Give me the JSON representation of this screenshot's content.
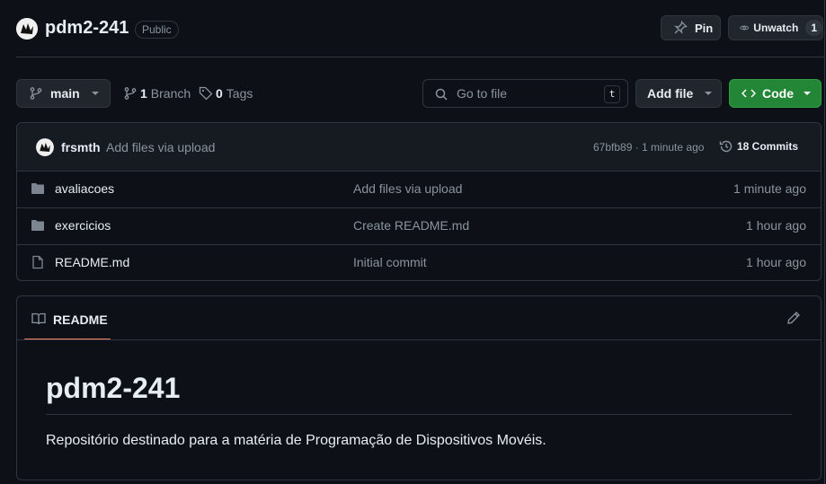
{
  "repo": {
    "name": "pdm2-241",
    "visibility": "Public",
    "avatar_icon": "avatar-icon"
  },
  "actions": {
    "pin_label": "Pin",
    "unwatch_label": "Unwatch",
    "watch_count": "1"
  },
  "branch_bar": {
    "branch_name": "main",
    "branch_count": "1",
    "branch_label": "Branch",
    "tag_count": "0",
    "tag_label": "Tags",
    "goto_placeholder": "Go to file",
    "goto_shortcut": "t",
    "add_file_label": "Add file",
    "code_label": "Code"
  },
  "latest_commit": {
    "author": "frsmth",
    "message": "Add files via upload",
    "hash_time": "67bfb89 · 1 minute ago",
    "commits_label": "18 Commits"
  },
  "files": [
    {
      "type": "folder",
      "name": "avaliacoes",
      "message": "Add files via upload",
      "time": "1 minute ago"
    },
    {
      "type": "folder",
      "name": "exercicios",
      "message": "Create README.md",
      "time": "1 hour ago"
    },
    {
      "type": "file",
      "name": "README.md",
      "message": "Initial commit",
      "time": "1 hour ago"
    }
  ],
  "readme": {
    "tab_label": "README",
    "heading": "pdm2-241",
    "description": "Repositório destinado para a matéria de Programação de Dispositivos Movéis."
  },
  "colors": {
    "background": "#0d1117",
    "border": "#30363d",
    "accent_green": "#238636",
    "tab_underline": "#f78166"
  }
}
